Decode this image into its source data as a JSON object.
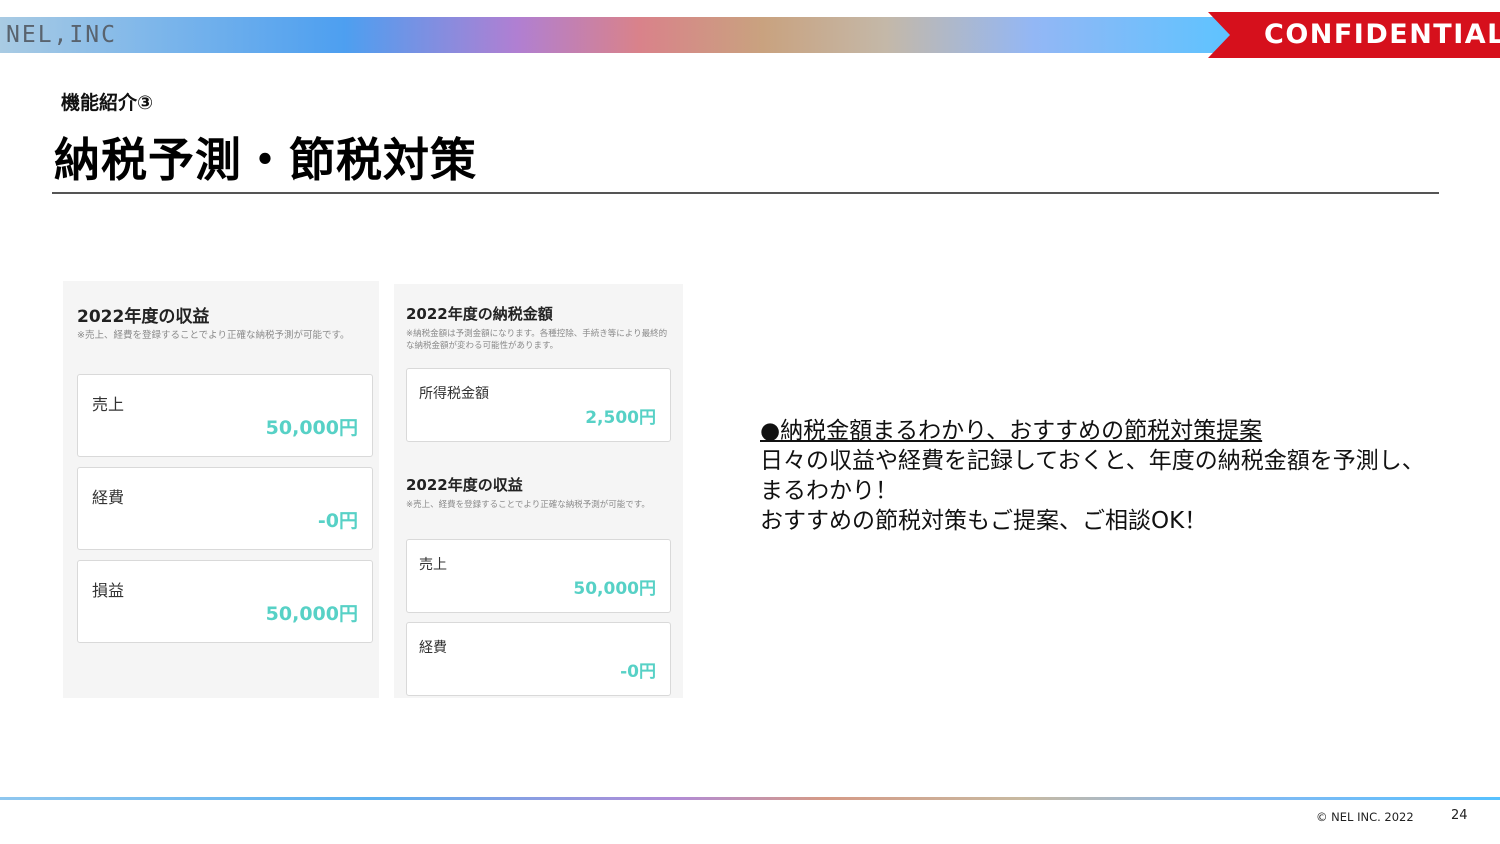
{
  "header": {
    "brand": "NEL,INC",
    "confidential": "CONFIDENTIAL"
  },
  "slide": {
    "subtitle": "機能紹介③",
    "title": "納税予測・節税対策"
  },
  "panel_left": {
    "title": "2022年度の収益",
    "note": "※売上、経費を登録することでより正確な納税予測が可能です。",
    "cards": [
      {
        "label": "売上",
        "value": "50,000円"
      },
      {
        "label": "経費",
        "value": "-0円"
      },
      {
        "label": "損益",
        "value": "50,000円"
      }
    ]
  },
  "panel_right": {
    "tax_title": "2022年度の納税金額",
    "tax_note": "※納税金額は予測金額になります。各種控除、手続き等により最終的な納税金額が変わる可能性があります。",
    "tax_card": {
      "label": "所得税金額",
      "value": "2,500円"
    },
    "income_title": "2022年度の収益",
    "income_note": "※売上、経費を登録することでより正確な納税予測が可能です。",
    "cards": [
      {
        "label": "売上",
        "value": "50,000円"
      },
      {
        "label": "経費",
        "value": "-0円"
      }
    ]
  },
  "description": {
    "headline": "●納税金額まるわかり、おすすめの節税対策提案",
    "line1": "日々の収益や経費を記録しておくと、年度の納税金額を予測し、まるわかり！",
    "line2": "おすすめの節税対策もご提案、ご相談OK！"
  },
  "footer": {
    "copyright": "© NEL INC. 2022",
    "page_number": "24"
  },
  "colors": {
    "confidential_red": "#d6101c",
    "value_teal": "#57d1c6"
  }
}
